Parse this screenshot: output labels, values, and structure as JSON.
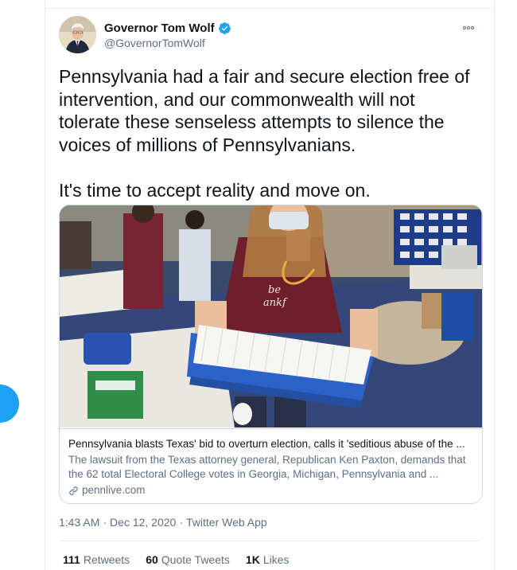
{
  "tweet": {
    "author": {
      "display_name": "Governor Tom Wolf",
      "handle": "@GovernorTomWolf",
      "verified_icon": "verified-badge-icon",
      "avatar_icon": "avatar-image"
    },
    "more_icon": "more-options-icon",
    "text": "Pennsylvania had a fair and secure election free of intervention, and our commonwealth will not tolerate these senseless attempts to silence the voices of millions of Pennsylvanians.\n\nIt's time to accept reality and move on.",
    "card": {
      "image_icon": "article-photo",
      "title": "Pennsylvania blasts Texas' bid to overturn election, calls it 'seditious abuse of the ...",
      "description": "The lawsuit from the Texas attorney general, Republican Ken Paxton, demands that the 62 total Electoral College votes in Georgia, Michigan, Pennsylvania and ...",
      "domain": "pennlive.com",
      "link_icon": "link-icon"
    },
    "meta": {
      "time": "1:43 AM",
      "separator": "·",
      "date": "Dec 12, 2020",
      "source": "Twitter Web App"
    },
    "stats": [
      {
        "count": "111",
        "label": "Retweets"
      },
      {
        "count": "60",
        "label": "Quote Tweets"
      },
      {
        "count": "1K",
        "label": "Likes"
      }
    ]
  },
  "colors": {
    "accent": "#1da1f2",
    "text_primary": "#0f1419",
    "text_secondary": "#5b7083",
    "border": "#cfd9de"
  }
}
